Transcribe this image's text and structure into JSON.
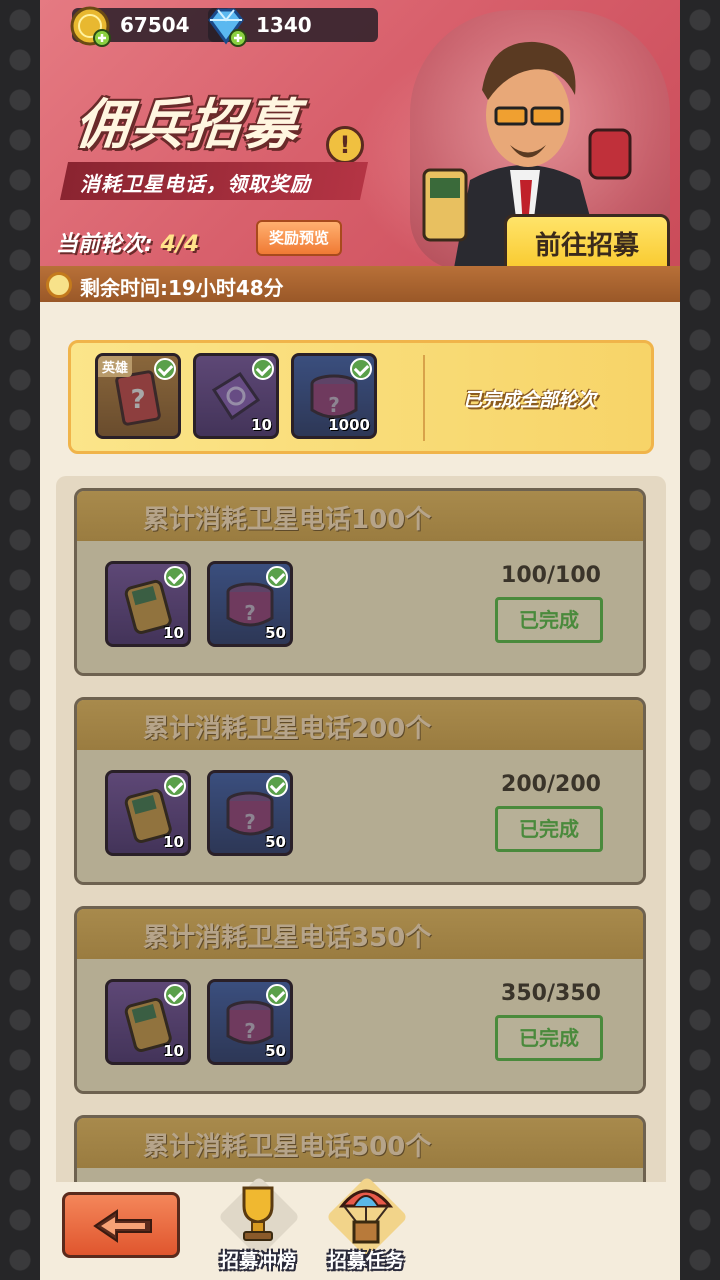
{
  "resources": {
    "gold": "67504",
    "gems": "1340"
  },
  "banner": {
    "title": "佣兵招募",
    "subtitle": "消耗卫星电话，领取奖励",
    "round_label": "当前轮次:",
    "round_value": "4/4",
    "preview_button": "奖励预览",
    "goto_button": "前往招募",
    "timer": "剩余时间:19小时48分"
  },
  "summary": {
    "items": [
      {
        "icon": "hero-card-icon",
        "tag": "英雄",
        "qty": ""
      },
      {
        "icon": "recruit-ticket-icon",
        "tag": "",
        "qty": "10"
      },
      {
        "icon": "mystery-can-icon",
        "tag": "",
        "qty": "1000"
      }
    ],
    "status": "已完成全部轮次"
  },
  "tasks": [
    {
      "title": "累计消耗卫星电话100个",
      "progress": "100/100",
      "status": "已完成",
      "rewards": [
        {
          "icon": "satellite-phone-icon",
          "qty": "10"
        },
        {
          "icon": "mystery-can-icon",
          "qty": "50"
        }
      ]
    },
    {
      "title": "累计消耗卫星电话200个",
      "progress": "200/200",
      "status": "已完成",
      "rewards": [
        {
          "icon": "satellite-phone-icon",
          "qty": "10"
        },
        {
          "icon": "mystery-can-icon",
          "qty": "50"
        }
      ]
    },
    {
      "title": "累计消耗卫星电话350个",
      "progress": "350/350",
      "status": "已完成",
      "rewards": [
        {
          "icon": "satellite-phone-icon",
          "qty": "10"
        },
        {
          "icon": "mystery-can-icon",
          "qty": "50"
        }
      ]
    },
    {
      "title": "累计消耗卫星电话500个"
    }
  ],
  "bottom_nav": {
    "tabs": [
      {
        "label": "招募冲榜",
        "icon": "trophy-icon",
        "active": false
      },
      {
        "label": "招募任务",
        "icon": "parachute-crate-icon",
        "active": true
      }
    ]
  },
  "colors": {
    "banner": "#d8606c",
    "accent_gold": "#f8c626",
    "done_green": "#4a8a3c"
  }
}
